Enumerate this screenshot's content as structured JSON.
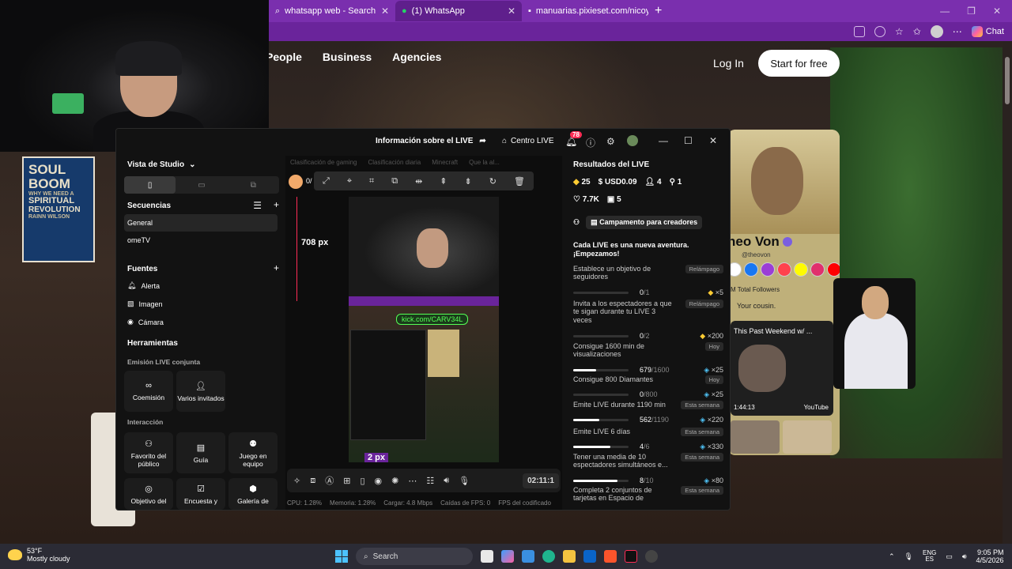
{
  "browser": {
    "tabs": [
      {
        "label": "whatsapp web - Search",
        "active": false
      },
      {
        "label": "(1) WhatsApp",
        "active": true
      },
      {
        "label": "manuarias.pixieset.com/nicoysant",
        "active": false
      }
    ],
    "new_tab": "+",
    "chat_label": "Chat"
  },
  "site": {
    "nav": [
      "People",
      "Business",
      "Agencies"
    ],
    "login": "Log In",
    "cta": "Start for free",
    "book": {
      "line1": "SOUL",
      "line2": "BOOM",
      "small": "WHY WE NEED A",
      "line3": "SPIRITUAL",
      "line4": "REVOLUTION",
      "author": "RAINN WILSON"
    }
  },
  "studio": {
    "top_title": "Información sobre el LIVE",
    "centro": "Centro LIVE",
    "notif_count": "78",
    "left": {
      "vista": "Vista de Studio",
      "secuencias": "Secuencias",
      "seq_items": [
        "General",
        "omeTV"
      ],
      "fuentes": "Fuentes",
      "fuentes_items": [
        "Alerta",
        "Imagen",
        "Cámara"
      ],
      "herramientas": "Herramientas",
      "emision": "Emisión LIVE conjunta",
      "cards1": [
        {
          "label": "Coemisión"
        },
        {
          "label": "Varios invitados"
        }
      ],
      "interaccion": "Interacción",
      "cards2": [
        {
          "label": "Favorito del público"
        },
        {
          "label": "Guía"
        },
        {
          "label": "Juego en equipo"
        }
      ],
      "cards3": [
        {
          "label": "Objetivo del"
        },
        {
          "label": "Encuesta y"
        },
        {
          "label": "Galería de"
        }
      ]
    },
    "center": {
      "game_tabs": [
        "Clasificación de gaming",
        "Clasificación diaria",
        "Minecraft",
        "Que la al..."
      ],
      "viewer_count": "0/",
      "px_label": "708 px",
      "kick": "kick.com/CARV34L",
      "px_label2": "2 px",
      "timer": "02:11:1",
      "stats": {
        "cpu": "CPU: 1.28%",
        "mem": "Memoria: 1.28%",
        "load": "Cargar: 4.8 Mbps",
        "fps": "Caídas de FPS: 0",
        "codec": "FPS del codificado"
      }
    },
    "right": {
      "title": "Resultados del LIVE",
      "metrics": {
        "diamonds": "25",
        "usd": "USD0.09",
        "viewers": "4",
        "new": "1",
        "likes": "7.7K",
        "gifts": "5"
      },
      "camp": "Campamento para creadores",
      "intro": "Cada LIVE es una nueva aventura. ¡Empezamos!",
      "goals": [
        {
          "text": "Establece un objetivo de seguidores",
          "tag": "Relámpago",
          "cur": "0",
          "total": "/1",
          "reward": "×5",
          "pct": 0
        },
        {
          "text": "Invita a los espectadores a que te sigan durante tu LIVE 3 veces",
          "tag": "Relámpago",
          "cur": "0",
          "total": "/2",
          "reward": "×200",
          "pct": 0
        },
        {
          "text": "Consigue 1600 min de visualizaciones",
          "tag": "Hoy",
          "cur": "679",
          "total": "/1600",
          "reward": "×25",
          "pct": 0.42
        },
        {
          "text": "Consigue 800 Diamantes",
          "tag": "Hoy",
          "cur": "0",
          "total": "/800",
          "reward": "×25",
          "pct": 0
        },
        {
          "text": "Emite LIVE durante 1190 min",
          "tag": "Esta semana",
          "cur": "562",
          "total": "/1190",
          "reward": "×220",
          "pct": 0.47
        },
        {
          "text": "Emite LIVE 6 días",
          "tag": "Esta semana",
          "cur": "4",
          "total": "/6",
          "reward": "×330",
          "pct": 0.67
        },
        {
          "text": "Tener una media de 10 espectadores simultáneos e...",
          "tag": "Esta semana",
          "cur": "8",
          "total": "/10",
          "reward": "×80",
          "pct": 0.8
        },
        {
          "text": "Completa 2 conjuntos de tarjetas en Espacio de",
          "tag": "Esta semana",
          "cur": "",
          "total": "",
          "reward": "",
          "pct": 0
        }
      ]
    }
  },
  "profile": {
    "name": "heo Von",
    "handle": "@theovon",
    "followers": "M Total Followers",
    "bio": "Your cousin.",
    "video_title": "This Past Weekend w/ ...",
    "video_time": "1:44:13",
    "video_brand": "YouTube"
  },
  "taskbar": {
    "temp": "53°F",
    "weather": "Mostly cloudy",
    "search": "Search",
    "lang1": "ENG",
    "lang2": "ES",
    "time": "9:05 PM",
    "date": "4/5/2026"
  },
  "colors": {
    "tab_bar": "#7a2fae",
    "accent_red": "#fe2c55",
    "taskbar": "#2b2b35"
  }
}
